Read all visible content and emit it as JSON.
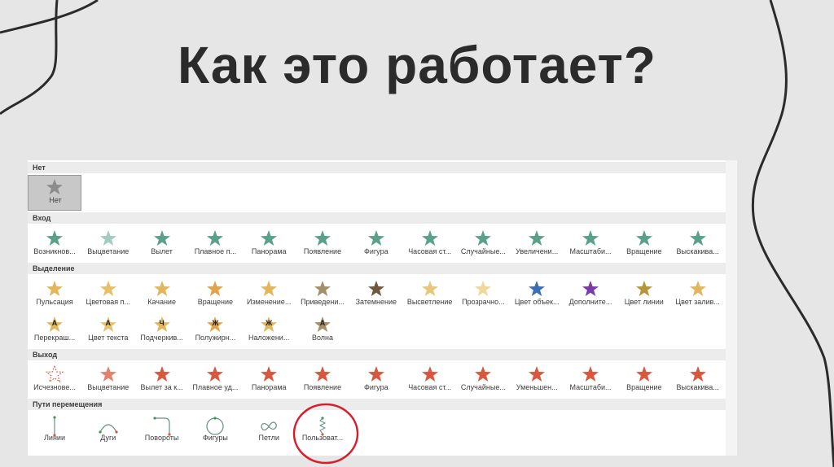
{
  "title": "Как это работает?",
  "colors": {
    "none": "#8c8c8c",
    "entrance": "#5aa08a",
    "emphasis": "#e2b65a",
    "exit": "#d9573f",
    "path": "#6a8f85",
    "circle": "#d81e2a"
  },
  "sections": {
    "none": {
      "header": "Нет",
      "items": [
        {
          "label": "Нет",
          "icon": "star-icon"
        }
      ]
    },
    "entrance": {
      "header": "Вход",
      "items": [
        {
          "label": "Возникнов...",
          "icon": "star-burst-icon"
        },
        {
          "label": "Выцветание",
          "icon": "star-fade-icon"
        },
        {
          "label": "Вылет",
          "icon": "star-fly-icon"
        },
        {
          "label": "Плавное п...",
          "icon": "star-float-icon"
        },
        {
          "label": "Панорама",
          "icon": "star-split-icon"
        },
        {
          "label": "Появление",
          "icon": "star-wipe-icon"
        },
        {
          "label": "Фигура",
          "icon": "star-shape-icon"
        },
        {
          "label": "Часовая ст...",
          "icon": "star-wheel-icon"
        },
        {
          "label": "Случайные...",
          "icon": "star-bars-icon"
        },
        {
          "label": "Увеличени...",
          "icon": "star-grow-icon"
        },
        {
          "label": "Масштаби...",
          "icon": "star-zoom-icon"
        },
        {
          "label": "Вращение",
          "icon": "star-swivel-icon"
        },
        {
          "label": "Выскакива...",
          "icon": "star-bounce-icon"
        }
      ]
    },
    "emphasis": {
      "header": "Выделение",
      "items": [
        {
          "label": "Пульсация",
          "icon": "star-pulse-icon"
        },
        {
          "label": "Цветовая п...",
          "icon": "star-color-pulse-icon"
        },
        {
          "label": "Качание",
          "icon": "star-teeter-icon"
        },
        {
          "label": "Вращение",
          "icon": "star-spin-icon"
        },
        {
          "label": "Изменение...",
          "icon": "star-grow-shrink-icon"
        },
        {
          "label": "Приведени...",
          "icon": "star-desaturate-icon"
        },
        {
          "label": "Затемнение",
          "icon": "star-darken-icon"
        },
        {
          "label": "Высветление",
          "icon": "star-lighten-icon"
        },
        {
          "label": "Прозрачно...",
          "icon": "star-transparency-icon"
        },
        {
          "label": "Цвет объек...",
          "icon": "star-object-color-icon"
        },
        {
          "label": "Дополните...",
          "icon": "star-complementary-icon"
        },
        {
          "label": "Цвет линии",
          "icon": "star-line-color-icon"
        },
        {
          "label": "Цвет залив...",
          "icon": "star-fill-color-icon"
        },
        {
          "label": "Перекраш...",
          "icon": "star-brush-color-icon",
          "letter": "A"
        },
        {
          "label": "Цвет текста",
          "icon": "star-font-color-icon",
          "letter": "A"
        },
        {
          "label": "Подчеркив...",
          "icon": "star-underline-icon",
          "letter": "Ч"
        },
        {
          "label": "Полужирн...",
          "icon": "star-bold-icon",
          "letter": "Ж"
        },
        {
          "label": "Наложени...",
          "icon": "star-bold-reveal-icon",
          "letter": "Ж"
        },
        {
          "label": "Волна",
          "icon": "star-wave-icon",
          "letter": "A"
        }
      ]
    },
    "exit": {
      "header": "Выход",
      "items": [
        {
          "label": "Исчезнове...",
          "icon": "star-disappear-icon"
        },
        {
          "label": "Выцветание",
          "icon": "star-fade-out-icon"
        },
        {
          "label": "Вылет за к...",
          "icon": "star-fly-out-icon"
        },
        {
          "label": "Плавное уд...",
          "icon": "star-float-out-icon"
        },
        {
          "label": "Панорама",
          "icon": "star-split-out-icon"
        },
        {
          "label": "Появление",
          "icon": "star-wipe-out-icon"
        },
        {
          "label": "Фигура",
          "icon": "star-shape-out-icon"
        },
        {
          "label": "Часовая ст...",
          "icon": "star-wheel-out-icon"
        },
        {
          "label": "Случайные...",
          "icon": "star-bars-out-icon"
        },
        {
          "label": "Уменьшен...",
          "icon": "star-shrink-icon"
        },
        {
          "label": "Масштаби...",
          "icon": "star-zoom-out-icon"
        },
        {
          "label": "Вращение",
          "icon": "star-swivel-out-icon"
        },
        {
          "label": "Выскакива...",
          "icon": "star-bounce-out-icon"
        }
      ]
    },
    "paths": {
      "header": "Пути перемещения",
      "items": [
        {
          "label": "Линии",
          "icon": "path-line-icon"
        },
        {
          "label": "Дуги",
          "icon": "path-arc-icon"
        },
        {
          "label": "Повороты",
          "icon": "path-turn-icon"
        },
        {
          "label": "Фигуры",
          "icon": "path-shape-icon"
        },
        {
          "label": "Петли",
          "icon": "path-loop-icon"
        },
        {
          "label": "Пользоват...",
          "icon": "path-custom-icon"
        }
      ]
    }
  }
}
